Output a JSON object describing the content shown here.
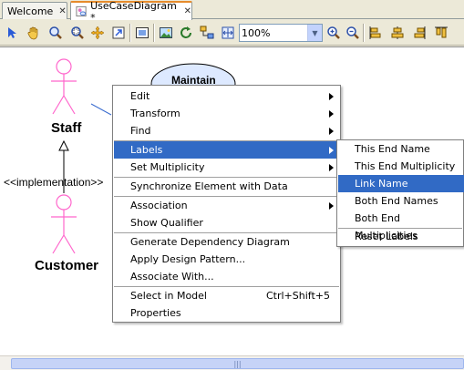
{
  "tabs": [
    {
      "label": "Welcome",
      "close": "✕"
    },
    {
      "label": "UseCaseDiagram *",
      "close": "✕"
    }
  ],
  "toolbar": {
    "icons": [
      "select-icon",
      "hand-icon",
      "zoom-area-icon",
      "zoom-icon",
      "pan-icon",
      "export-icon",
      "fit-icon",
      "image-icon",
      "refresh-icon",
      "layout-icon",
      "fit-page-icon",
      "zoom-in-icon",
      "zoom-out-icon",
      "align-left-icon",
      "align-center-icon",
      "align-right-icon",
      "align-top-icon"
    ],
    "zoom_value": "100%"
  },
  "diagram": {
    "actor_staff": "Staff",
    "actor_customer": "Customer",
    "implementation_label": "<<implementation>>",
    "usecase_label": "Maintain",
    "actor_color": "#ff66cc"
  },
  "context_menu": {
    "items": [
      {
        "label": "Edit",
        "submenu": true
      },
      {
        "label": "Transform",
        "submenu": true
      },
      {
        "label": "Find",
        "submenu": true
      },
      {
        "label": "Labels",
        "submenu": true,
        "highlighted": true
      },
      {
        "label": "Set Multiplicity",
        "submenu": true
      },
      {
        "label": "Synchronize Element with Data"
      },
      {
        "label": "Association",
        "submenu": true
      },
      {
        "label": "Show Qualifier"
      },
      {
        "label": "Generate Dependency Diagram"
      },
      {
        "label": "Apply Design Pattern..."
      },
      {
        "label": "Associate With..."
      },
      {
        "label": "Select in Model",
        "accelerator": "Ctrl+Shift+5"
      },
      {
        "label": "Properties"
      }
    ]
  },
  "labels_submenu": {
    "items": [
      {
        "label": "This End Name"
      },
      {
        "label": "This End Multiplicity"
      },
      {
        "label": "Link Name",
        "highlighted": true
      },
      {
        "label": "Both End Names"
      },
      {
        "label": "Both End Multiplicities"
      },
      {
        "label": "Reset Labels"
      }
    ]
  },
  "colors": {
    "highlight": "#316ac5",
    "accent_tab": "#e68b2c"
  }
}
